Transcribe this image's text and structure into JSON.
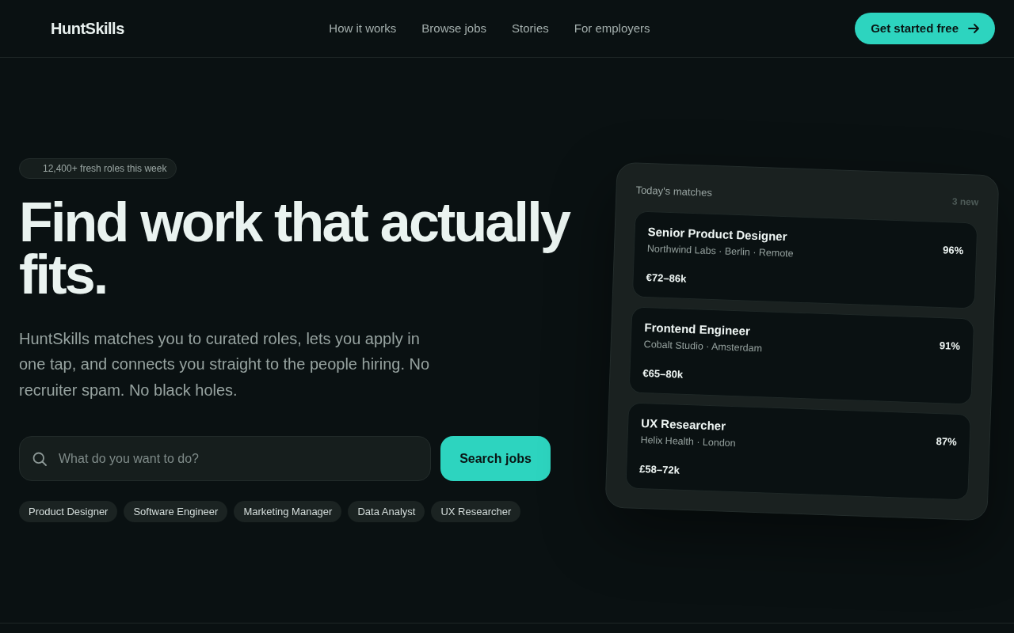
{
  "header": {
    "logo": "HuntSkills",
    "nav": [
      "How it works",
      "Browse jobs",
      "Stories",
      "For employers"
    ],
    "cta": "Get started free"
  },
  "hero": {
    "badge": "12,400+ fresh roles this week",
    "title": "Find work that actually fits.",
    "subtitle": "HuntSkills matches you to curated roles, lets you apply in one tap, and connects you straight to the people hiring. No recruiter spam. No black holes.",
    "search": {
      "placeholder": "What do you want to do?",
      "button": "Search jobs"
    },
    "suggestions": [
      "Product Designer",
      "Software Engineer",
      "Marketing Manager",
      "Data Analyst",
      "UX Researcher"
    ]
  },
  "matches_card": {
    "title": "Today's matches",
    "count": "3 new",
    "jobs": [
      {
        "title": "Senior Product Designer",
        "company": "Northwind Labs · Berlin · Remote",
        "salary": "€72–86k",
        "match": "96%"
      },
      {
        "title": "Frontend Engineer",
        "company": "Cobalt Studio · Amsterdam",
        "salary": "€65–80k",
        "match": "91%"
      },
      {
        "title": "UX Researcher",
        "company": "Helix Health · London",
        "salary": "£58–72k",
        "match": "87%"
      }
    ]
  }
}
